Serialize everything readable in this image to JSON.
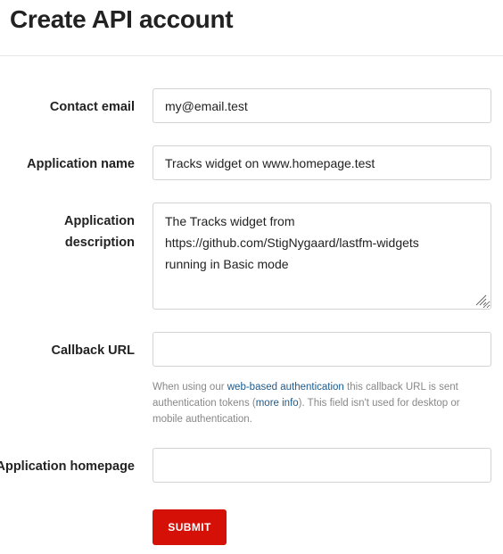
{
  "page": {
    "title": "Create API account"
  },
  "form": {
    "contact_email": {
      "label": "Contact email",
      "value": "my@email.test"
    },
    "application_name": {
      "label": "Application name",
      "value": "Tracks widget on www.homepage.test"
    },
    "application_description": {
      "label_line1": "Application",
      "label_line2": "description",
      "value": "The Tracks widget from\nhttps://github.com/StigNygaard/lastfm-widgets\nrunning in Basic mode"
    },
    "callback_url": {
      "label": "Callback URL",
      "value": "",
      "help": {
        "part1": "When using our ",
        "link1": "web-based authentication",
        "part2": " this callback URL is sent authentication tokens (",
        "link2": "more info",
        "part3": "). This field isn't used for desktop or mobile authentication."
      }
    },
    "application_homepage": {
      "label": "Application homepage",
      "value": ""
    },
    "submit_label": "SUBMIT"
  },
  "colors": {
    "submit_bg": "#d51007",
    "link": "#1a5b8f",
    "help_text": "#888888"
  }
}
